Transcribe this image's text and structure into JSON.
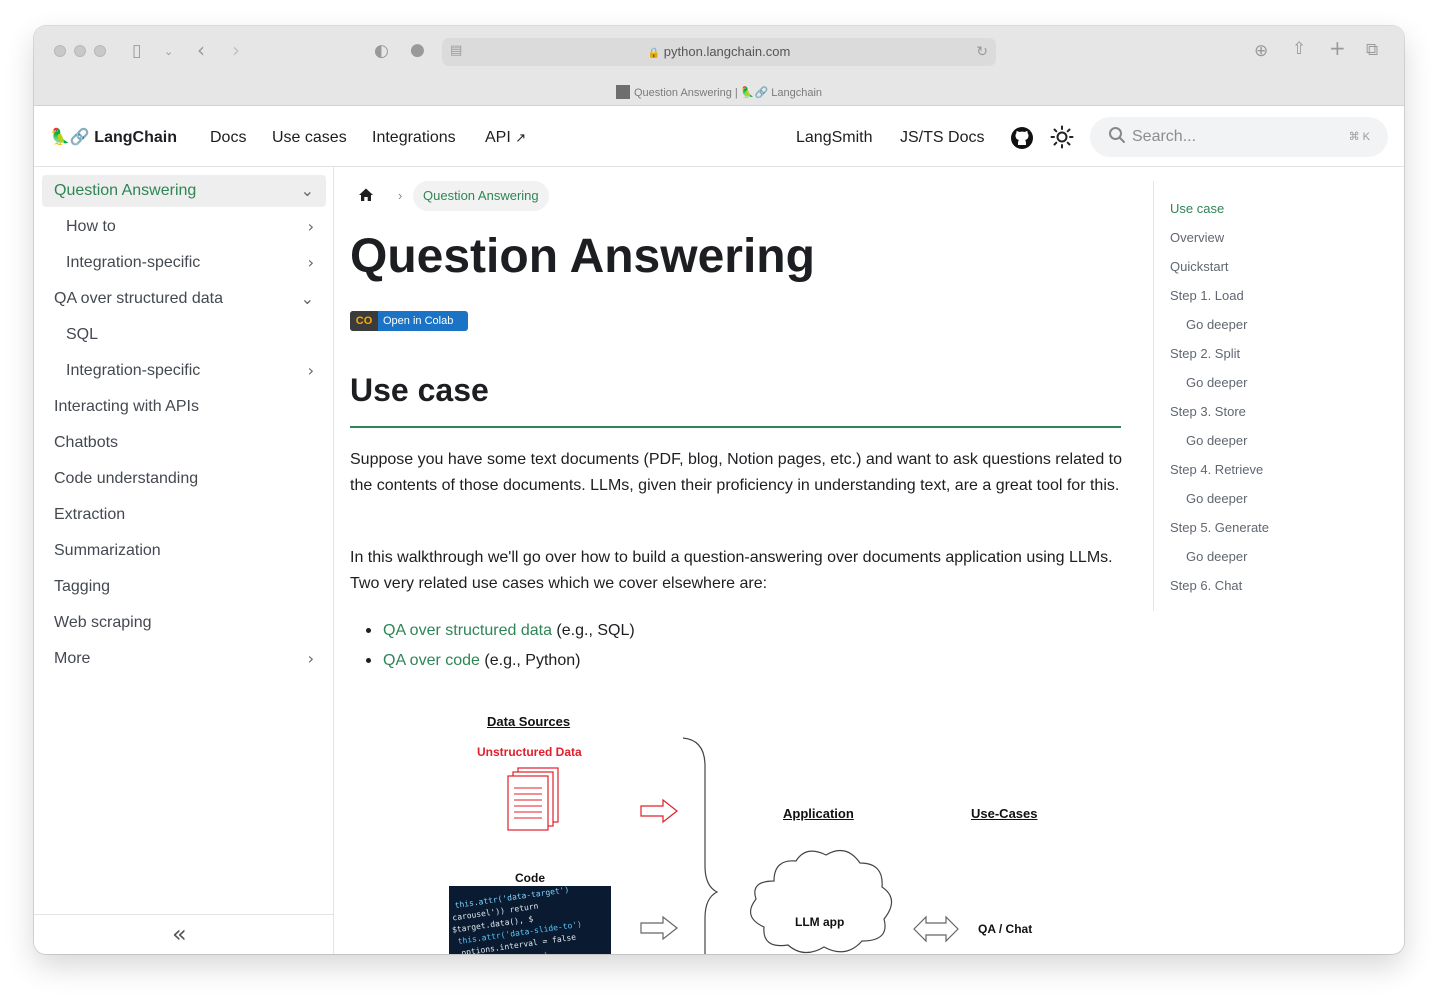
{
  "browser": {
    "url": "python.langchain.com",
    "tab_title": "Question Answering | 🦜🔗 Langchain"
  },
  "navbar": {
    "brand_emoji": "🦜🔗",
    "brand_name": "LangChain",
    "links": [
      "Docs",
      "Use cases",
      "Integrations",
      "API"
    ],
    "right_links": [
      "LangSmith",
      "JS/TS Docs"
    ],
    "search_placeholder": "Search...",
    "search_shortcut": "⌘ K"
  },
  "sidebar": {
    "items": [
      {
        "label": "Question Answering",
        "active": true,
        "chevron": "down"
      },
      {
        "label": "How to",
        "chevron": "right"
      },
      {
        "label": "Integration-specific",
        "chevron": "right"
      },
      {
        "label": "QA over structured data",
        "chevron": "down"
      },
      {
        "label": "SQL"
      },
      {
        "label": "Integration-specific",
        "chevron": "right"
      },
      {
        "label": "Interacting with APIs"
      },
      {
        "label": "Chatbots"
      },
      {
        "label": "Code understanding"
      },
      {
        "label": "Extraction"
      },
      {
        "label": "Summarization"
      },
      {
        "label": "Tagging"
      },
      {
        "label": "Web scraping"
      },
      {
        "label": "More",
        "chevron": "right"
      }
    ]
  },
  "main": {
    "breadcrumb": "Question Answering",
    "title": "Question Answering",
    "colab_label": "Open in Colab",
    "colab_logo": "CO",
    "section_title": "Use case",
    "para1": "Suppose you have some text documents (PDF, blog, Notion pages, etc.) and want to ask questions related to the contents of those documents. LLMs, given their proficiency in understanding text, are a great tool for this.",
    "para2": "In this walkthrough we'll go over how to build a question-answering over documents application using LLMs. Two very related use cases which we cover elsewhere are:",
    "bullets": [
      {
        "link": "QA over structured data",
        "rest": " (e.g., SQL)"
      },
      {
        "link": "QA over code",
        "rest": " (e.g., Python)"
      }
    ]
  },
  "toc": {
    "items": [
      "Use case",
      "Overview",
      "Quickstart",
      "Step 1. Load",
      "Go deeper",
      "Step 2. Split",
      "Go deeper",
      "Step 3. Store",
      "Go deeper",
      "Step 4. Retrieve",
      "Go deeper",
      "Step 5. Generate",
      "Go deeper",
      "Step 6. Chat"
    ]
  },
  "diagram": {
    "data_sources": "Data Sources",
    "unstructured": "Unstructured Data",
    "code": "Code",
    "application": "Application",
    "use_cases": "Use-Cases",
    "llm_app": "LLM app",
    "qa_chat": "QA / Chat"
  },
  "colors": {
    "accent": "#2e8555",
    "red": "#e0202a"
  }
}
